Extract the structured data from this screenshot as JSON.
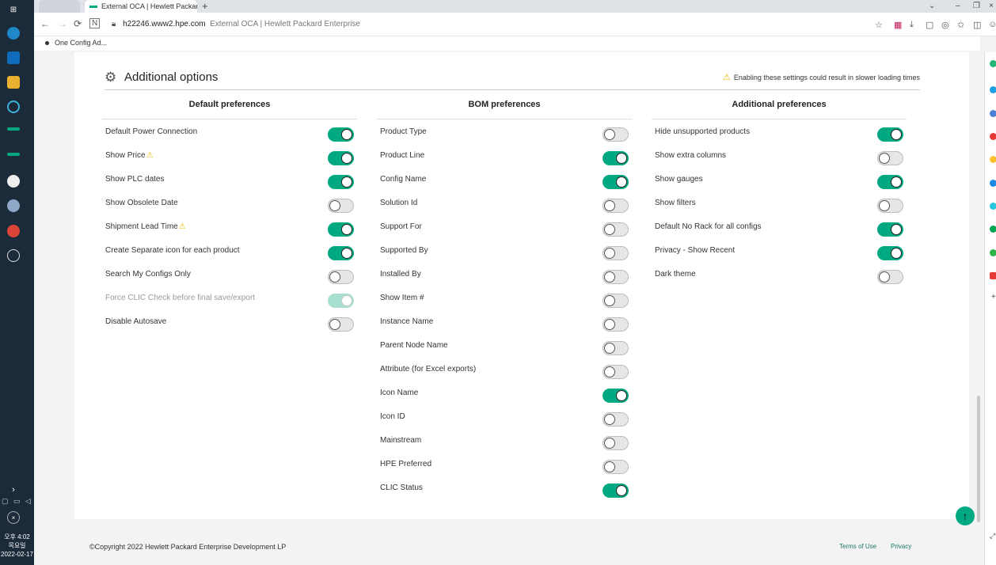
{
  "browser": {
    "tab_title": "External OCA  | Hewlett Packard",
    "url_host": "h22246.www2.hpe.com",
    "url_title": "External OCA  | Hewlett Packard Enterprise",
    "bookmark": "One Config Ad..."
  },
  "taskbar": {
    "time": "오후 4:02",
    "day": "목요일",
    "date": "2022-02-17"
  },
  "section": {
    "title": "Additional options",
    "warning": "Enabling these settings could result in slower loading times"
  },
  "columns": [
    {
      "header": "Default preferences",
      "rows": [
        {
          "label": "Default Power Connection",
          "on": true
        },
        {
          "label": "Show Price",
          "on": true,
          "warn": true
        },
        {
          "label": "Show PLC dates",
          "on": true
        },
        {
          "label": "Show Obsolete Date",
          "on": false
        },
        {
          "label": "Shipment Lead Time",
          "on": true,
          "warn": true
        },
        {
          "label": "Create Separate icon for each product",
          "on": true
        },
        {
          "label": "Search My Configs Only",
          "on": false
        },
        {
          "label": "Force CLIC Check before final save/export",
          "on": true,
          "disabled": true
        },
        {
          "label": "Disable Autosave",
          "on": false
        }
      ]
    },
    {
      "header": "BOM preferences",
      "rows": [
        {
          "label": "Product Type",
          "on": false
        },
        {
          "label": "Product Line",
          "on": true
        },
        {
          "label": "Config Name",
          "on": true
        },
        {
          "label": "Solution Id",
          "on": false
        },
        {
          "label": "Support For",
          "on": false
        },
        {
          "label": "Supported By",
          "on": false
        },
        {
          "label": "Installed By",
          "on": false
        },
        {
          "label": "Show Item #",
          "on": false
        },
        {
          "label": "Instance Name",
          "on": false
        },
        {
          "label": "Parent Node Name",
          "on": false
        },
        {
          "label": "Attribute (for Excel exports)",
          "on": false
        },
        {
          "label": "Icon Name",
          "on": true
        },
        {
          "label": "Icon ID",
          "on": false
        },
        {
          "label": "Mainstream",
          "on": false
        },
        {
          "label": "HPE Preferred",
          "on": false
        },
        {
          "label": "CLIC Status",
          "on": true
        }
      ]
    },
    {
      "header": "Additional preferences",
      "rows": [
        {
          "label": "Hide unsupported products",
          "on": true
        },
        {
          "label": "Show extra columns",
          "on": false
        },
        {
          "label": "Show gauges",
          "on": true
        },
        {
          "label": "Show filters",
          "on": false
        },
        {
          "label": "Default No Rack for all configs",
          "on": true
        },
        {
          "label": "Privacy - Show Recent",
          "on": true
        },
        {
          "label": "Dark theme",
          "on": false
        }
      ]
    }
  ],
  "footer": {
    "copyright": "©Copyright 2022 Hewlett Packard Enterprise Development LP",
    "terms": "Terms of Use",
    "privacy": "Privacy"
  },
  "colors": {
    "accent": "#01a982",
    "toggle_off": "#e6e6e6",
    "warning": "#e6b800"
  }
}
